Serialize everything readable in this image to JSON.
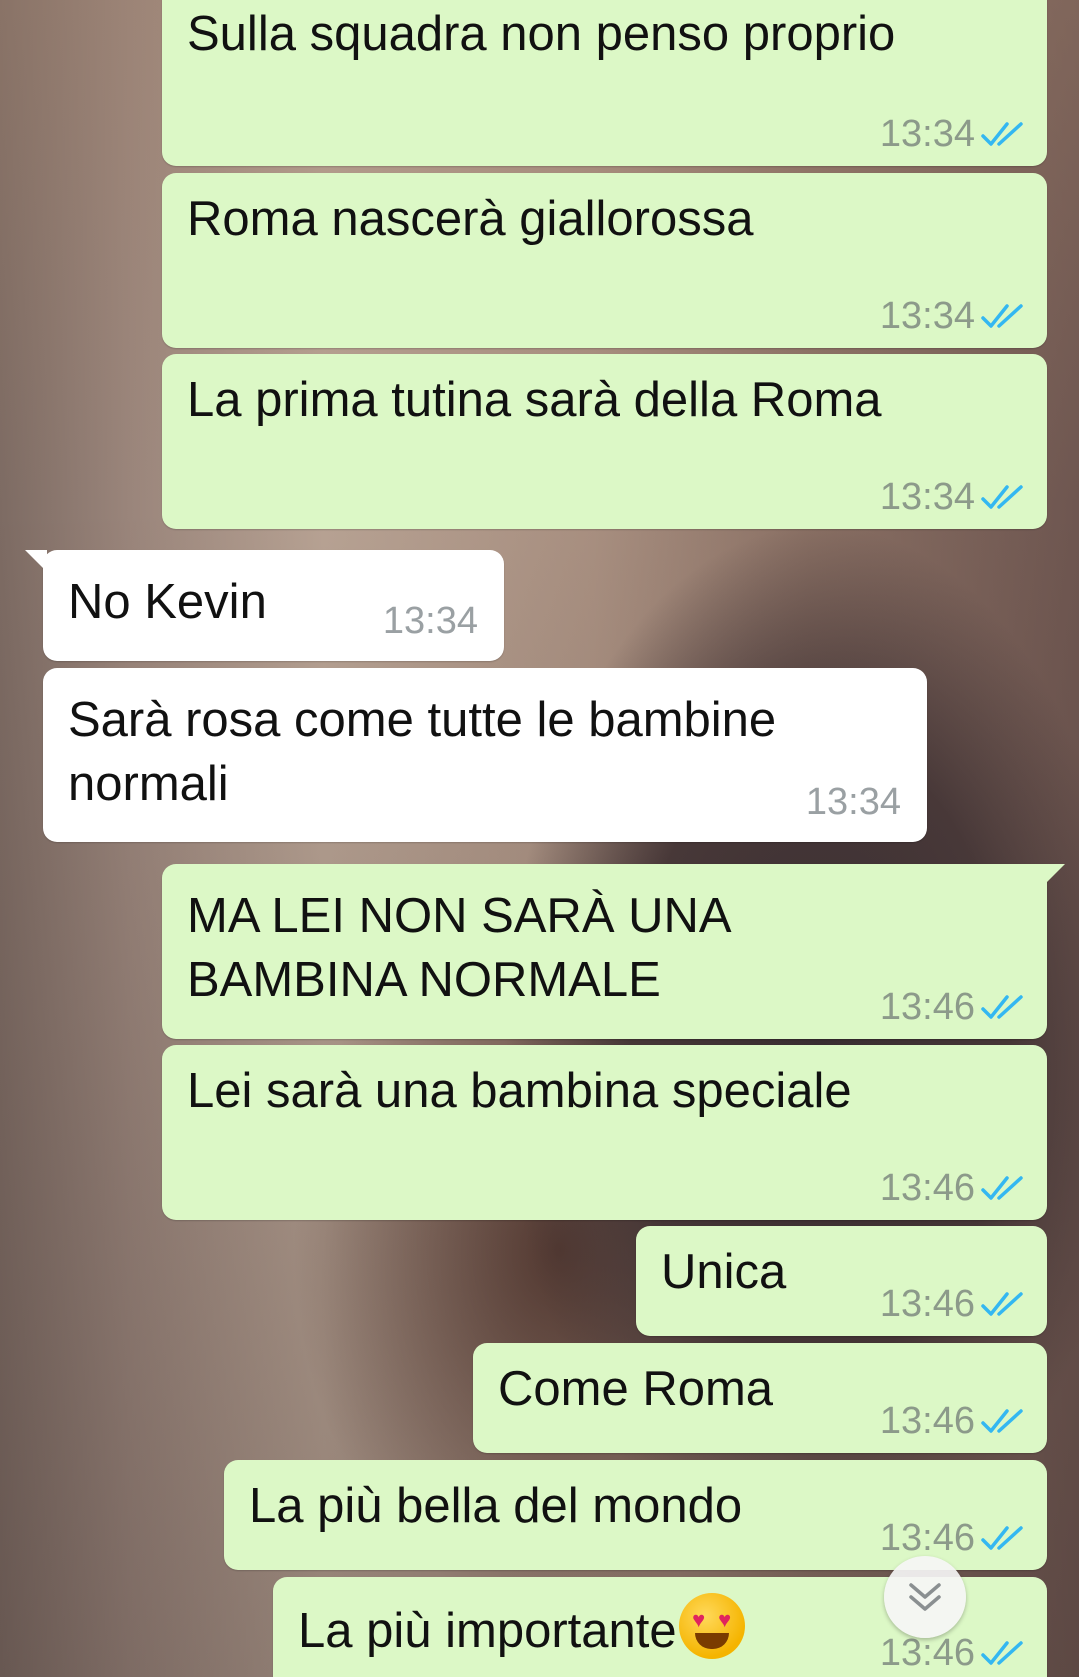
{
  "colors": {
    "outgoing": "#dcf8c6",
    "incoming": "#ffffff",
    "read_ticks": "#34b7f1"
  },
  "messages": [
    {
      "text": "Sulla squadra non penso proprio",
      "time": "13:34",
      "direction": "out",
      "status": "read"
    },
    {
      "text": "Roma nascerà giallorossa",
      "time": "13:34",
      "direction": "out",
      "status": "read"
    },
    {
      "text": "La prima tutina sarà della Roma",
      "time": "13:34",
      "direction": "out",
      "status": "read"
    },
    {
      "text": "No Kevin",
      "time": "13:34",
      "direction": "in"
    },
    {
      "text": "Sarà rosa come tutte le bambine\nnormali",
      "time": "13:34",
      "direction": "in"
    },
    {
      "text": "MA LEI NON SARÀ UNA\nBAMBINA NORMALE",
      "time": "13:46",
      "direction": "out",
      "status": "read"
    },
    {
      "text": "Lei sarà una bambina speciale",
      "time": "13:46",
      "direction": "out",
      "status": "read"
    },
    {
      "text": "Unica",
      "time": "13:46",
      "direction": "out",
      "status": "read"
    },
    {
      "text": "Come Roma",
      "time": "13:46",
      "direction": "out",
      "status": "read"
    },
    {
      "text": "La più bella del mondo",
      "time": "13:46",
      "direction": "out",
      "status": "read"
    },
    {
      "text": "La più importante",
      "emoji": "heart-eyes-emoji",
      "time": "13:46",
      "direction": "out",
      "status": "read"
    }
  ],
  "scroll_button": {
    "icon": "double-chevron-down-icon"
  }
}
